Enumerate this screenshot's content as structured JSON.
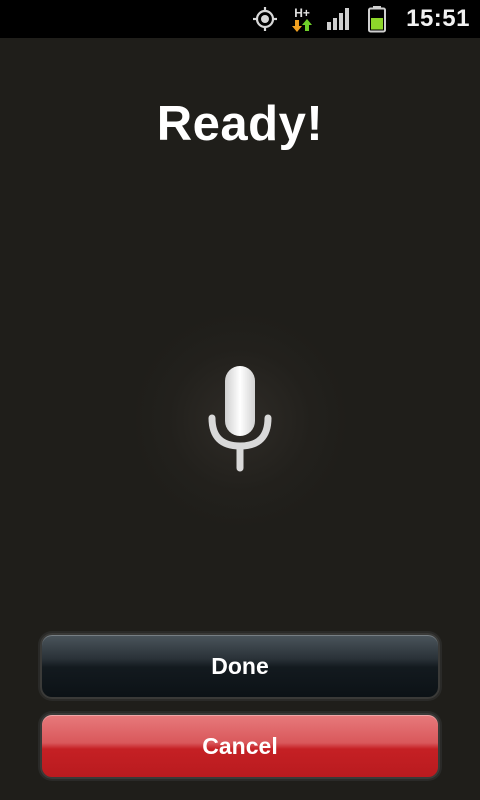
{
  "status_bar": {
    "icons": [
      "gps-icon",
      "hplus-data-icon",
      "signal-icon",
      "battery-icon"
    ],
    "network_label": "H+",
    "time": "15:51"
  },
  "title": "Ready!",
  "mic": {
    "icon": "microphone-icon"
  },
  "buttons": {
    "done_label": "Done",
    "cancel_label": "Cancel"
  },
  "colors": {
    "background": "#1f1e1a",
    "status_bar": "#000000",
    "done_button": "#131a1f",
    "cancel_button": "#c52024",
    "battery": "#8dd62a",
    "data_up_arrow": "#6fd02a",
    "data_down_arrow": "#f0a020"
  }
}
